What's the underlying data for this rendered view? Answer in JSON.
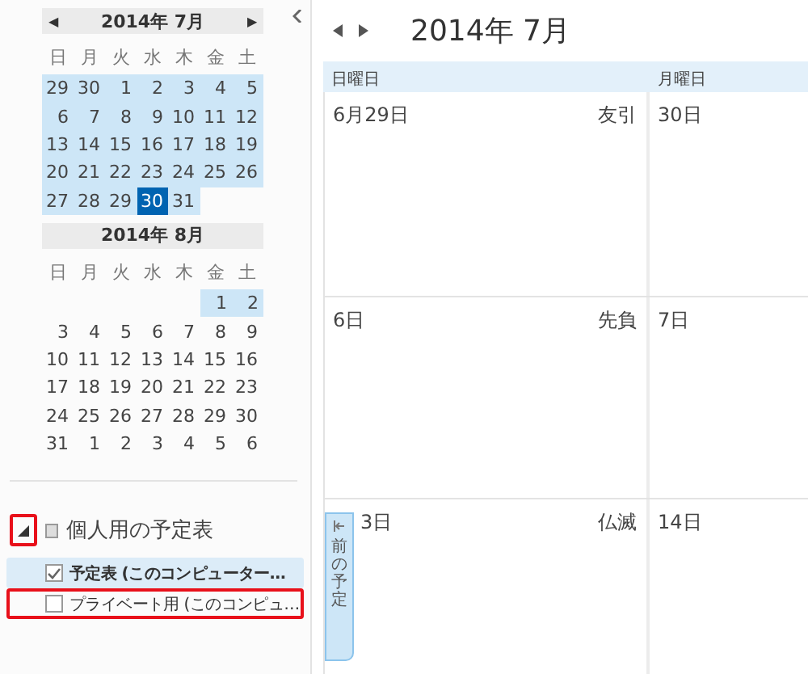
{
  "mini_calendars": [
    {
      "title": "2014年 7月",
      "prev": "◀",
      "next": "▶",
      "weekdays": [
        "日",
        "月",
        "火",
        "水",
        "木",
        "金",
        "土"
      ],
      "weeks": [
        [
          {
            "d": "29",
            "in_range": true,
            "selected": false
          },
          {
            "d": "30",
            "in_range": true,
            "selected": false
          },
          {
            "d": "1",
            "in_range": true,
            "selected": false
          },
          {
            "d": "2",
            "in_range": true,
            "selected": false
          },
          {
            "d": "3",
            "in_range": true,
            "selected": false
          },
          {
            "d": "4",
            "in_range": true,
            "selected": false
          },
          {
            "d": "5",
            "in_range": true,
            "selected": false
          }
        ],
        [
          {
            "d": "6",
            "in_range": true,
            "selected": false
          },
          {
            "d": "7",
            "in_range": true,
            "selected": false
          },
          {
            "d": "8",
            "in_range": true,
            "selected": false
          },
          {
            "d": "9",
            "in_range": true,
            "selected": false
          },
          {
            "d": "10",
            "in_range": true,
            "selected": false
          },
          {
            "d": "11",
            "in_range": true,
            "selected": false
          },
          {
            "d": "12",
            "in_range": true,
            "selected": false
          }
        ],
        [
          {
            "d": "13",
            "in_range": true,
            "selected": false
          },
          {
            "d": "14",
            "in_range": true,
            "selected": false
          },
          {
            "d": "15",
            "in_range": true,
            "selected": false
          },
          {
            "d": "16",
            "in_range": true,
            "selected": false
          },
          {
            "d": "17",
            "in_range": true,
            "selected": false
          },
          {
            "d": "18",
            "in_range": true,
            "selected": false
          },
          {
            "d": "19",
            "in_range": true,
            "selected": false
          }
        ],
        [
          {
            "d": "20",
            "in_range": true,
            "selected": false
          },
          {
            "d": "21",
            "in_range": true,
            "selected": false
          },
          {
            "d": "22",
            "in_range": true,
            "selected": false
          },
          {
            "d": "23",
            "in_range": true,
            "selected": false
          },
          {
            "d": "24",
            "in_range": true,
            "selected": false
          },
          {
            "d": "25",
            "in_range": true,
            "selected": false
          },
          {
            "d": "26",
            "in_range": true,
            "selected": false
          }
        ],
        [
          {
            "d": "27",
            "in_range": true,
            "selected": false
          },
          {
            "d": "28",
            "in_range": true,
            "selected": false
          },
          {
            "d": "29",
            "in_range": true,
            "selected": false
          },
          {
            "d": "30",
            "in_range": true,
            "selected": true
          },
          {
            "d": "31",
            "in_range": true,
            "selected": false
          }
        ]
      ]
    },
    {
      "title": "2014年 8月",
      "weekdays": [
        "日",
        "月",
        "火",
        "水",
        "木",
        "金",
        "土"
      ],
      "weeks": [
        [
          {
            "d": "1",
            "in_range": true,
            "selected": false
          },
          {
            "d": "2",
            "in_range": true,
            "selected": false
          }
        ],
        [
          {
            "d": "3",
            "in_range": false,
            "selected": false
          },
          {
            "d": "4",
            "in_range": false,
            "selected": false
          },
          {
            "d": "5",
            "in_range": false,
            "selected": false
          },
          {
            "d": "6",
            "in_range": false,
            "selected": false
          },
          {
            "d": "7",
            "in_range": false,
            "selected": false
          },
          {
            "d": "8",
            "in_range": false,
            "selected": false
          },
          {
            "d": "9",
            "in_range": false,
            "selected": false
          }
        ],
        [
          {
            "d": "10",
            "in_range": false,
            "selected": false
          },
          {
            "d": "11",
            "in_range": false,
            "selected": false
          },
          {
            "d": "12",
            "in_range": false,
            "selected": false
          },
          {
            "d": "13",
            "in_range": false,
            "selected": false
          },
          {
            "d": "14",
            "in_range": false,
            "selected": false
          },
          {
            "d": "15",
            "in_range": false,
            "selected": false
          },
          {
            "d": "16",
            "in_range": false,
            "selected": false
          }
        ],
        [
          {
            "d": "17",
            "in_range": false,
            "selected": false
          },
          {
            "d": "18",
            "in_range": false,
            "selected": false
          },
          {
            "d": "19",
            "in_range": false,
            "selected": false
          },
          {
            "d": "20",
            "in_range": false,
            "selected": false
          },
          {
            "d": "21",
            "in_range": false,
            "selected": false
          },
          {
            "d": "22",
            "in_range": false,
            "selected": false
          },
          {
            "d": "23",
            "in_range": false,
            "selected": false
          }
        ],
        [
          {
            "d": "24",
            "in_range": false,
            "selected": false
          },
          {
            "d": "25",
            "in_range": false,
            "selected": false
          },
          {
            "d": "26",
            "in_range": false,
            "selected": false
          },
          {
            "d": "27",
            "in_range": false,
            "selected": false
          },
          {
            "d": "28",
            "in_range": false,
            "selected": false
          },
          {
            "d": "29",
            "in_range": false,
            "selected": false
          },
          {
            "d": "30",
            "in_range": false,
            "selected": false
          }
        ],
        [
          {
            "d": "31",
            "in_range": false,
            "selected": false
          },
          {
            "d": "1",
            "in_range": false,
            "selected": false
          },
          {
            "d": "2",
            "in_range": false,
            "selected": false
          },
          {
            "d": "3",
            "in_range": false,
            "selected": false
          },
          {
            "d": "4",
            "in_range": false,
            "selected": false
          },
          {
            "d": "5",
            "in_range": false,
            "selected": false
          },
          {
            "d": "6",
            "in_range": false,
            "selected": false
          }
        ]
      ]
    }
  ],
  "calendar_group": {
    "label": "個人用の予定表",
    "expanded": true,
    "callout": true,
    "items": [
      {
        "label": "予定表 (このコンピューター…",
        "checked": true,
        "selected": true,
        "callout": false
      },
      {
        "label": "プライベート用 (このコンピュ…",
        "checked": false,
        "selected": false,
        "callout": true
      }
    ]
  },
  "main": {
    "title": "2014年 7月",
    "columns": [
      "日曜日",
      "月曜日"
    ],
    "weeks": [
      [
        {
          "date": "6月29日",
          "rokuyo": "友引"
        },
        {
          "date": "30日"
        }
      ],
      [
        {
          "date": "6日",
          "rokuyo": "先負"
        },
        {
          "date": "7日"
        }
      ],
      [
        {
          "date": "3日",
          "rokuyo": "仏滅"
        },
        {
          "date": "14日"
        }
      ]
    ],
    "peek_tab": {
      "label": "前の予定"
    }
  }
}
